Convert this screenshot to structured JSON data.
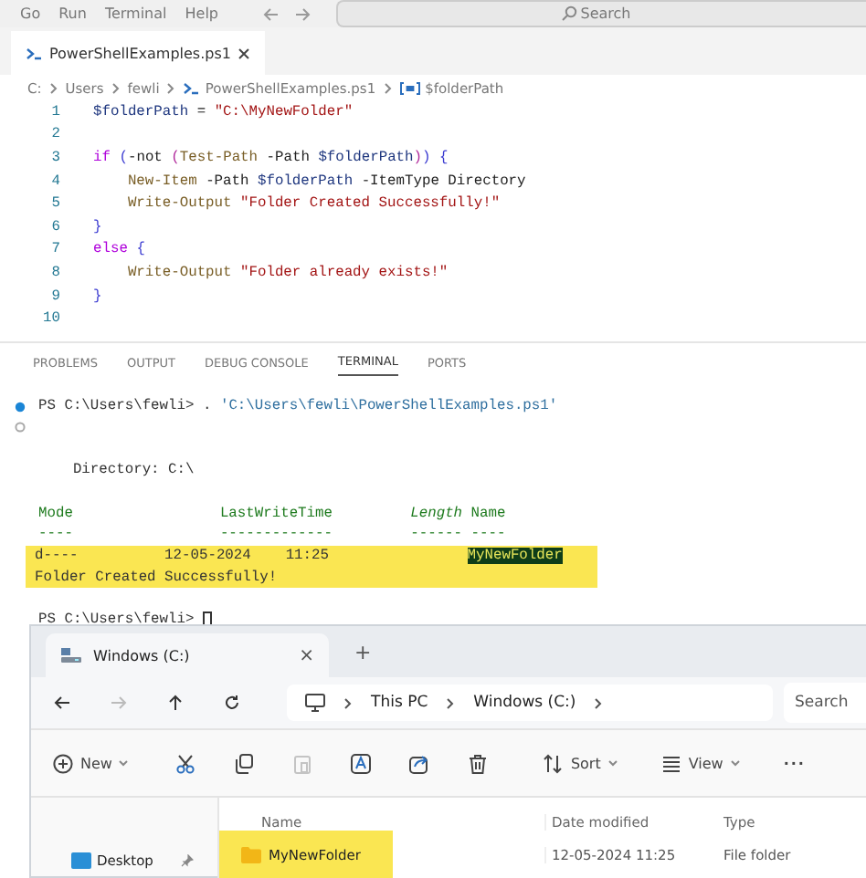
{
  "menu": [
    "Go",
    "Run",
    "Terminal",
    "Help"
  ],
  "title_search": {
    "placeholder": "Search"
  },
  "editor_tabs": [
    {
      "label": "PowerShellExamples.ps1",
      "selected": true,
      "kind": "powershell"
    }
  ],
  "breadcrumb": [
    {
      "label": "C:",
      "kind": "plain"
    },
    {
      "label": "Users",
      "kind": "plain"
    },
    {
      "label": "fewli",
      "kind": "plain"
    },
    {
      "label": "PowerShellExamples.ps1",
      "kind": "powershell"
    },
    {
      "label": "$folderPath",
      "kind": "variable"
    }
  ],
  "code": [
    {
      "number": "1",
      "tokens": [
        {
          "kind": "variable",
          "text": "$folderPath"
        },
        {
          "kind": "plain",
          "text": " = "
        },
        {
          "kind": "string",
          "text": "\"C:\\MyNewFolder\""
        }
      ]
    },
    {
      "number": "2"
    },
    {
      "number": "3",
      "tokens": [
        {
          "kind": "keyword",
          "text": "if"
        },
        {
          "kind": "bracket",
          "text": " ("
        },
        {
          "kind": "plain",
          "text": "-not "
        },
        {
          "kind": "bracket2",
          "text": "("
        },
        {
          "kind": "command",
          "text": "Test-Path"
        },
        {
          "kind": "plain",
          "text": " -Path "
        },
        {
          "kind": "variable",
          "text": "$folderPath"
        },
        {
          "kind": "bracket2",
          "text": ")"
        },
        {
          "kind": "bracket",
          "text": ") {"
        }
      ]
    },
    {
      "number": "4",
      "tokens": [
        {
          "kind": "command",
          "text": "    New-Item"
        },
        {
          "kind": "plain",
          "text": " -Path "
        },
        {
          "kind": "variable",
          "text": "$folderPath"
        },
        {
          "kind": "plain",
          "text": " -ItemType Directory"
        }
      ]
    },
    {
      "number": "5",
      "tokens": [
        {
          "kind": "command",
          "text": "    Write-Output"
        },
        {
          "kind": "string",
          "text": " \"Folder Created Successfully!\""
        }
      ]
    },
    {
      "number": "6",
      "tokens": [
        {
          "kind": "bracket",
          "text": "}"
        }
      ]
    },
    {
      "number": "7",
      "tokens": [
        {
          "kind": "keyword",
          "text": "else"
        },
        {
          "kind": "bracket",
          "text": " {"
        }
      ]
    },
    {
      "number": "8",
      "tokens": [
        {
          "kind": "command",
          "text": "    Write-Output"
        },
        {
          "kind": "string",
          "text": " \"Folder already exists!\""
        }
      ]
    },
    {
      "number": "9",
      "tokens": [
        {
          "kind": "bracket",
          "text": "}"
        }
      ]
    },
    {
      "number": "10"
    }
  ],
  "panel_tabs": [
    {
      "label": "PROBLEMS",
      "selected": false
    },
    {
      "label": "OUTPUT",
      "selected": false
    },
    {
      "label": "DEBUG CONSOLE",
      "selected": false
    },
    {
      "label": "TERMINAL",
      "selected": true
    },
    {
      "label": "PORTS",
      "selected": false
    }
  ],
  "terminal": [
    {
      "kind": "command",
      "tokens": [
        {
          "kind": "plain",
          "text": "PS C:\\Users\\fewli> . "
        },
        {
          "kind": "string",
          "text": "'C:\\Users\\fewli\\PowerShellExamples.ps1'"
        }
      ]
    },
    {
      "kind": "pending"
    },
    {
      "kind": "blank"
    },
    {
      "kind": "output",
      "tokens": [
        {
          "kind": "plain",
          "text": "    Directory: C:\\"
        }
      ]
    },
    {
      "kind": "blank"
    },
    {
      "kind": "output",
      "tokens": [
        {
          "kind": "header",
          "text": "Mode                 LastWriteTime         "
        },
        {
          "kind": "header-italic",
          "text": "Length"
        },
        {
          "kind": "header",
          "text": " Name"
        }
      ]
    },
    {
      "kind": "output",
      "tokens": [
        {
          "kind": "header",
          "text": "----                 -------------         ------ ----"
        }
      ]
    },
    {
      "kind": "output",
      "highlighted": true,
      "tokens": [
        {
          "kind": "plain",
          "text": "d----          12-05-2024    11:25                "
        },
        {
          "kind": "selection",
          "text": "MyNewFolder"
        }
      ]
    },
    {
      "kind": "output",
      "highlighted": true,
      "tokens": [
        {
          "kind": "plain",
          "text": "Folder Created Successfully!"
        }
      ]
    },
    {
      "kind": "blank"
    },
    {
      "kind": "prompt",
      "tokens": [
        {
          "kind": "plain",
          "text": "PS C:\\Users\\fewli> "
        }
      ]
    }
  ],
  "explorer": {
    "tab": {
      "label": "Windows (C:)",
      "close": "×",
      "new_tab": "+"
    },
    "nav": [
      {
        "kind": "back",
        "disabled": false
      },
      {
        "kind": "forward",
        "disabled": true
      },
      {
        "kind": "up",
        "disabled": false
      },
      {
        "kind": "refresh",
        "disabled": false
      }
    ],
    "address": [
      "This PC",
      "Windows (C:)"
    ],
    "search": {
      "placeholder": "Search"
    },
    "toolbar": [
      {
        "kind": "new",
        "label": "New",
        "disabled": false
      },
      {
        "kind": "cut",
        "disabled": false
      },
      {
        "kind": "copy",
        "disabled": false
      },
      {
        "kind": "paste",
        "disabled": true
      },
      {
        "kind": "rename",
        "disabled": false
      },
      {
        "kind": "share",
        "disabled": false
      },
      {
        "kind": "delete",
        "disabled": false
      },
      {
        "kind": "sort",
        "label": "Sort",
        "disabled": false
      },
      {
        "kind": "view",
        "label": "View",
        "disabled": false
      },
      {
        "kind": "more",
        "label": "···",
        "disabled": false
      }
    ],
    "sidebar": [
      {
        "label": "Desktop",
        "pinned": true
      }
    ],
    "columns": [
      "Name",
      "Date modified",
      "Type"
    ],
    "rows": [
      {
        "name": "MyNewFolder",
        "date": "12-05-2024 11:25",
        "type": "File folder",
        "highlighted": true
      }
    ]
  }
}
